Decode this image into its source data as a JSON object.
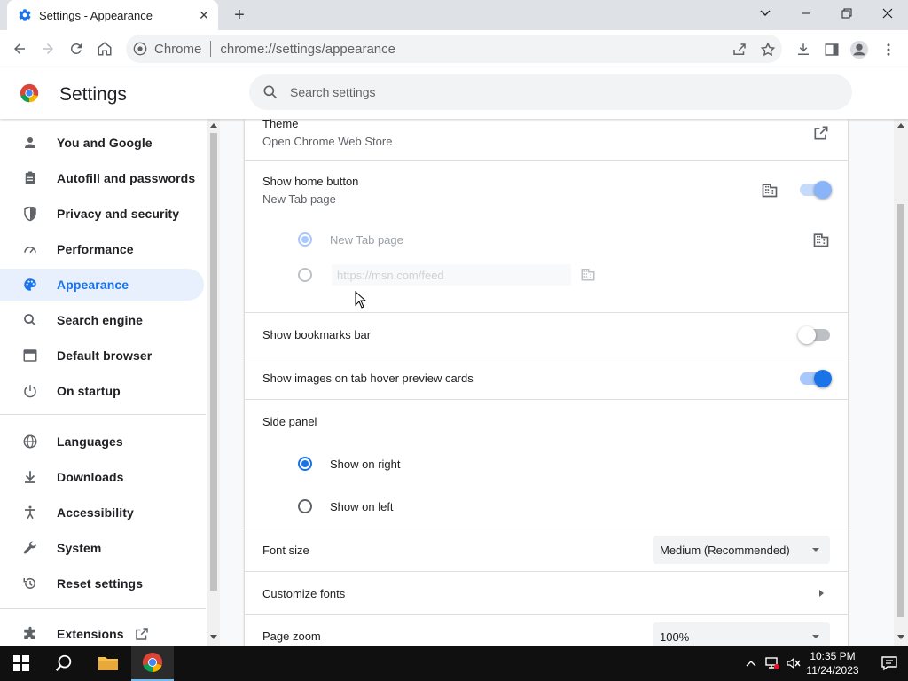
{
  "browser": {
    "tab_title": "Settings - Appearance",
    "omnibox_chip": "Chrome",
    "url": "chrome://settings/appearance"
  },
  "header": {
    "title": "Settings",
    "search_placeholder": "Search settings"
  },
  "sidebar": {
    "items": [
      {
        "label": "You and Google",
        "icon": "person-icon"
      },
      {
        "label": "Autofill and passwords",
        "icon": "clipboard-icon"
      },
      {
        "label": "Privacy and security",
        "icon": "shield-icon"
      },
      {
        "label": "Performance",
        "icon": "speedometer-icon"
      },
      {
        "label": "Appearance",
        "icon": "palette-icon",
        "active": true
      },
      {
        "label": "Search engine",
        "icon": "search-icon"
      },
      {
        "label": "Default browser",
        "icon": "browser-window-icon"
      },
      {
        "label": "On startup",
        "icon": "power-icon"
      },
      {
        "label": "Languages",
        "icon": "globe-icon"
      },
      {
        "label": "Downloads",
        "icon": "download-icon"
      },
      {
        "label": "Accessibility",
        "icon": "accessibility-icon"
      },
      {
        "label": "System",
        "icon": "wrench-icon"
      },
      {
        "label": "Reset settings",
        "icon": "reset-icon"
      },
      {
        "label": "Extensions",
        "icon": "puzzle-icon"
      }
    ]
  },
  "appearance": {
    "theme": {
      "title": "Theme",
      "subtitle": "Open Chrome Web Store"
    },
    "home_button": {
      "title": "Show home button",
      "subtitle": "New Tab page",
      "enabled": true
    },
    "home_options": {
      "new_tab_label": "New Tab page",
      "url_placeholder": "https://msn.com/feed"
    },
    "bookmarks_bar": {
      "title": "Show bookmarks bar",
      "enabled": false
    },
    "hover_images": {
      "title": "Show images on tab hover preview cards",
      "enabled": true
    },
    "side_panel": {
      "title": "Side panel",
      "right_label": "Show on right",
      "left_label": "Show on left",
      "selected": "right"
    },
    "font_size": {
      "title": "Font size",
      "value": "Medium (Recommended)"
    },
    "customize_fonts": {
      "title": "Customize fonts"
    },
    "page_zoom": {
      "title": "Page zoom",
      "value": "100%"
    }
  },
  "taskbar": {
    "time": "10:35 PM",
    "date": "11/24/2023"
  },
  "colors": {
    "accent": "#1a73e8",
    "active_bg": "#e8f0fe"
  }
}
